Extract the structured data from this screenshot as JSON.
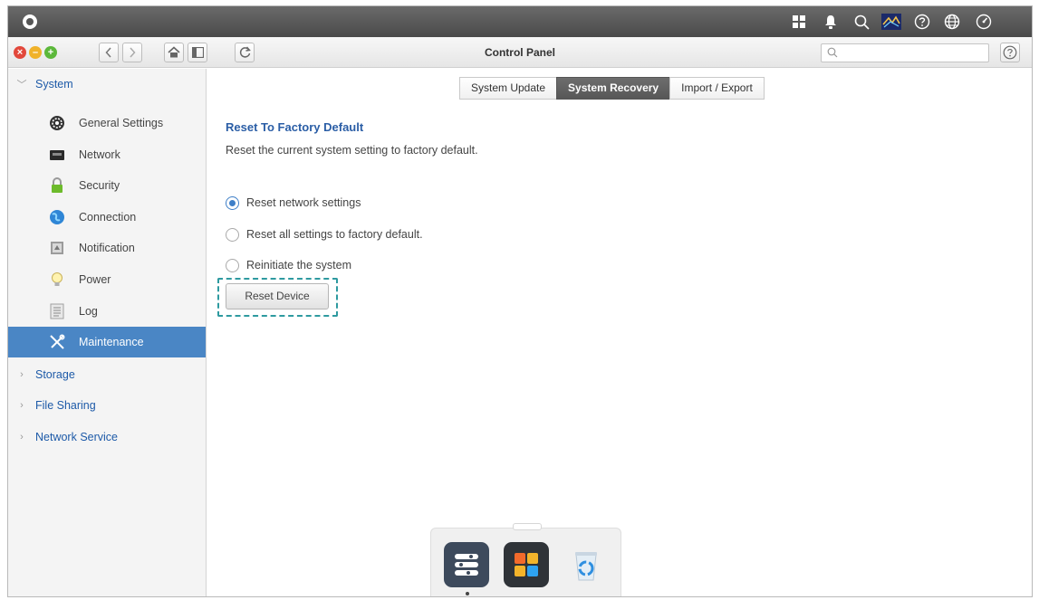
{
  "window": {
    "title": "Control Panel"
  },
  "search": {
    "placeholder": ""
  },
  "sidebar": {
    "system_label": "System",
    "system_items": [
      {
        "label": "General Settings",
        "icon": "gear-icon"
      },
      {
        "label": "Network",
        "icon": "network-card-icon"
      },
      {
        "label": "Security",
        "icon": "lock-icon"
      },
      {
        "label": "Connection",
        "icon": "globe-icon"
      },
      {
        "label": "Notification",
        "icon": "notification-icon"
      },
      {
        "label": "Power",
        "icon": "lightbulb-icon"
      },
      {
        "label": "Log",
        "icon": "log-icon"
      },
      {
        "label": "Maintenance",
        "icon": "tools-icon",
        "active": true
      }
    ],
    "sections": [
      {
        "label": "Storage"
      },
      {
        "label": "File Sharing"
      },
      {
        "label": "Network Service"
      }
    ]
  },
  "tabs": [
    {
      "label": "System Update"
    },
    {
      "label": "System Recovery",
      "active": true
    },
    {
      "label": "Import / Export"
    }
  ],
  "content": {
    "title": "Reset To Factory Default",
    "description": "Reset the current system setting to factory default.",
    "options": [
      {
        "label": "Reset network settings",
        "checked": true
      },
      {
        "label": "Reset all settings to factory default.",
        "checked": false
      },
      {
        "label": "Reinitiate the system",
        "checked": false
      }
    ],
    "button_label": "Reset Device"
  },
  "dock": {
    "apps": [
      {
        "icon": "control-panel-icon"
      },
      {
        "icon": "app-center-icon"
      },
      {
        "icon": "recycle-bin-icon"
      }
    ]
  },
  "colors": {
    "accent": "#4a86c5",
    "link": "#2b5ea6",
    "highlight": "#2e9aa0"
  }
}
